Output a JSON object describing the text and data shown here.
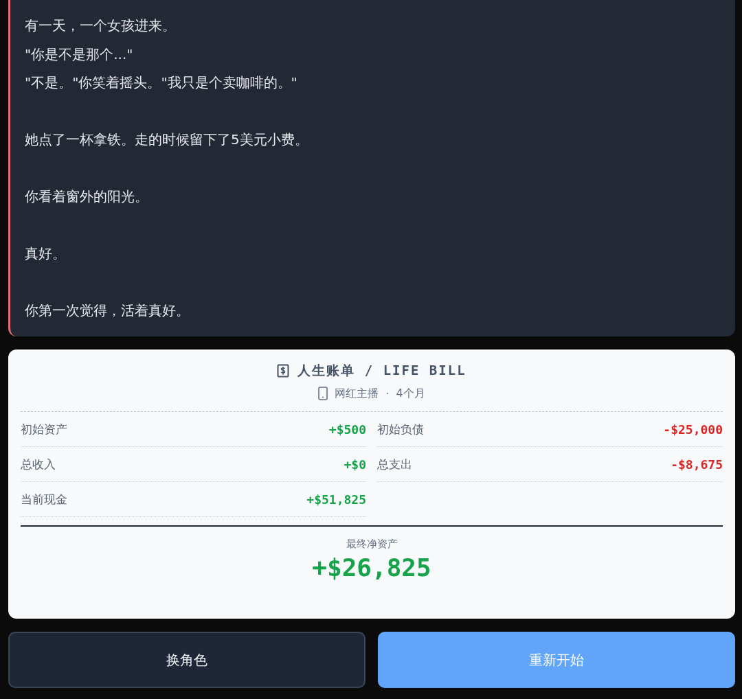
{
  "story": {
    "paragraphs": [
      {
        "lines": [
          "有一天，一个女孩进来。",
          "\"你是不是那个...\"",
          "\"不是。\"你笑着摇头。\"我只是个卖咖啡的。\""
        ]
      },
      {
        "lines": [
          "她点了一杯拿铁。走的时候留下了5美元小费。"
        ]
      },
      {
        "lines": [
          "你看着窗外的阳光。"
        ]
      },
      {
        "lines": [
          "真好。"
        ]
      },
      {
        "lines": [
          "你第一次觉得，活着真好。"
        ]
      }
    ]
  },
  "bill": {
    "title": "人生账单 / LIFE BILL",
    "role": "网红主播",
    "separator": "·",
    "duration": "4个月",
    "items": [
      {
        "label": "初始资产",
        "amount": "+$500",
        "color": "#16a34a"
      },
      {
        "label": "初始负债",
        "amount": "-$25,000",
        "color": "#dc2626"
      },
      {
        "label": "总收入",
        "amount": "+$0",
        "color": "#16a34a"
      },
      {
        "label": "总支出",
        "amount": "-$8,675",
        "color": "#dc2626"
      },
      {
        "label": "当前现金",
        "amount": "+$51,825",
        "color": "#16a34a"
      }
    ],
    "net_label": "最终净资产",
    "net_amount": "+$26,825"
  },
  "buttons": [
    {
      "label": "换角色",
      "kind": "secondary"
    },
    {
      "label": "重新开始",
      "kind": "primary"
    }
  ]
}
